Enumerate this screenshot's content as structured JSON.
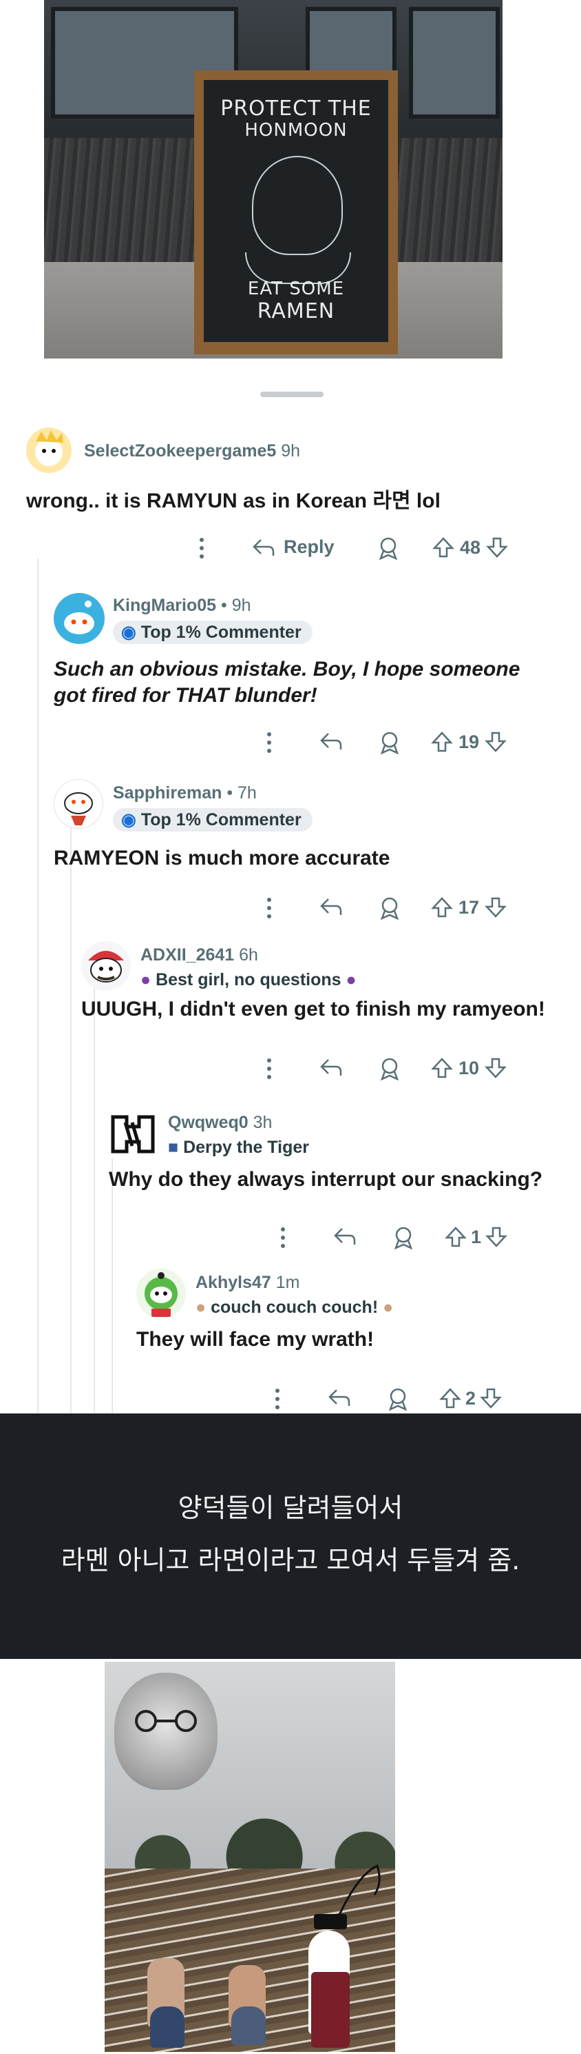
{
  "top_photo": {
    "sign_line1": "PROTECT THE",
    "sign_line2": "HONMOON",
    "sign_line3": "EAT SOME",
    "sign_line4": "RAMEN"
  },
  "comments": [
    {
      "author": "SelectZookeepergame5",
      "age": "9h",
      "body": "wrong.. it is RAMYUN as in Korean 라면 lol",
      "reply_label": "Reply",
      "score": "48",
      "avatar_color": "#f4c43a"
    },
    {
      "author": "KingMario05",
      "age": "9h",
      "flair": "Top 1% Commenter",
      "body_line1": "Such an obvious mistake. Boy, I hope someone",
      "body_line2": "got fired for THAT blunder!",
      "score": "19",
      "avatar_color": "#3bb1e0"
    },
    {
      "author": "Sapphireman",
      "age": "7h",
      "flair": "Top 1% Commenter",
      "body": "RAMYEON is much more accurate",
      "score": "17",
      "avatar_color": "#ffffff"
    },
    {
      "author": "ADXII_2641",
      "age": "6h",
      "flair": "Best girl, no questions",
      "body": "UUUGH, I didn't even get to finish my ramyeon!",
      "score": "10",
      "avatar_color": "#d8343a"
    },
    {
      "author": "Qwqweq0",
      "age": "3h",
      "flair": "Derpy the Tiger",
      "body": "Why do they always interrupt our snacking?",
      "score": "1",
      "avatar_color": "#111111"
    },
    {
      "author": "Akhyls47",
      "age": "1m",
      "flair": "couch couch couch!",
      "body": "They will face my wrath!",
      "score": "2",
      "avatar_color": "#58b947"
    }
  ],
  "caption": {
    "line1": "양덕들이 달려들어서",
    "line2": "라멘 아니고 라면이라고 모여서 두들겨 줌."
  },
  "colors": {
    "banner_bg": "#1c1f24",
    "meta_gray": "#576f76",
    "flair_bg": "#eaedef"
  }
}
